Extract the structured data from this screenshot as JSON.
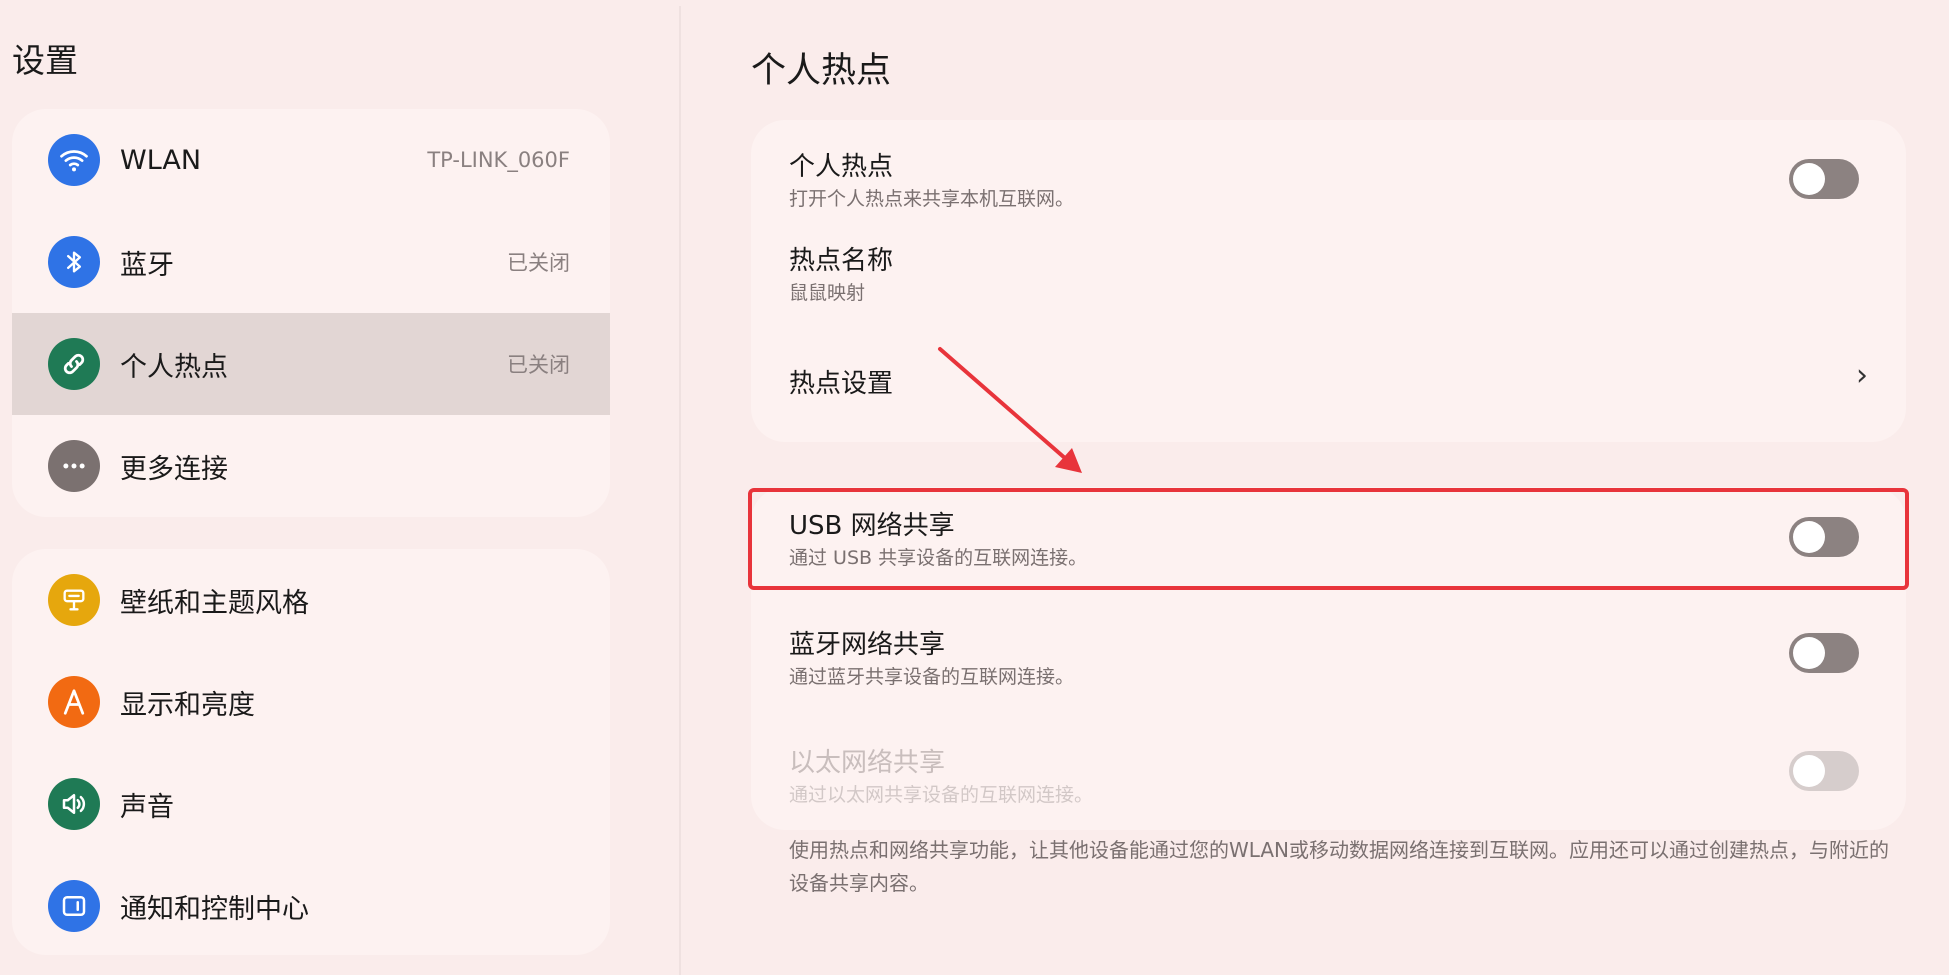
{
  "sidebar": {
    "title": "设置",
    "group1": [
      {
        "label": "WLAN",
        "value": "TP-LINK_060F",
        "icon": "wifi-icon",
        "color": "#2f73e6"
      },
      {
        "label": "蓝牙",
        "value": "已关闭",
        "icon": "bluetooth-icon",
        "color": "#2f73e6"
      },
      {
        "label": "个人热点",
        "value": "已关闭",
        "icon": "link-icon",
        "color": "#1f7a55",
        "selected": true
      },
      {
        "label": "更多连接",
        "value": "",
        "icon": "more-icon",
        "color": "#7b7170"
      }
    ],
    "group2": [
      {
        "label": "壁纸和主题风格",
        "icon": "theme-icon",
        "color": "#e6a70d"
      },
      {
        "label": "显示和亮度",
        "icon": "display-icon",
        "color": "#f26a12"
      },
      {
        "label": "声音",
        "icon": "sound-icon",
        "color": "#1f7a55"
      },
      {
        "label": "通知和控制中心",
        "icon": "notification-icon",
        "color": "#2f73e6"
      }
    ]
  },
  "main": {
    "title": "个人热点",
    "hotspot": {
      "title": "个人热点",
      "subtitle": "打开个人热点来共享本机互联网。",
      "enabled": false
    },
    "hotspot_name": {
      "title": "热点名称",
      "subtitle": "鼠鼠映射"
    },
    "hotspot_settings": {
      "title": "热点设置"
    },
    "usb_tether": {
      "title": "USB 网络共享",
      "subtitle": "通过 USB 共享设备的互联网连接。",
      "enabled": false
    },
    "bt_tether": {
      "title": "蓝牙网络共享",
      "subtitle": "通过蓝牙共享设备的互联网连接。",
      "enabled": false
    },
    "eth_tether": {
      "title": "以太网络共享",
      "subtitle": "通过以太网共享设备的互联网连接。",
      "enabled": false,
      "disabled": true
    },
    "footnote": "使用热点和网络共享功能，让其他设备能通过您的WLAN或移动数据网络连接到互联网。应用还可以通过创建热点，与附近的设备共享内容。"
  },
  "colors": {
    "background": "#faeceb",
    "card": "#fdf2f1",
    "selected": "#e2d6d4",
    "highlight": "#e8343b",
    "toggle_off": "#8c8281"
  }
}
